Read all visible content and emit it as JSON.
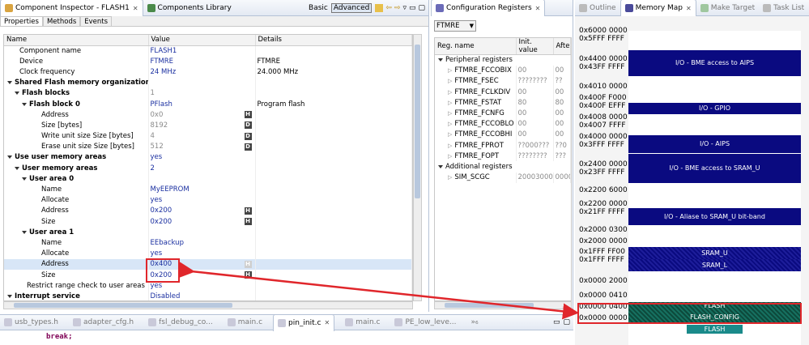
{
  "left_panel": {
    "tabs": [
      {
        "label": "Component Inspector - FLASH1"
      },
      {
        "label": "Components Library"
      }
    ],
    "toolbar": {
      "basic": "Basic",
      "advanced": "Advanced"
    },
    "subtabs": [
      "Properties",
      "Methods",
      "Events"
    ],
    "columns": [
      "Name",
      "Value",
      "Details"
    ],
    "rows": [
      {
        "name": "Component name",
        "value": "FLASH1",
        "details": "",
        "indent": 1,
        "bold": false,
        "vclass": "blue",
        "btn": ""
      },
      {
        "name": "Device",
        "value": "FTMRE",
        "details": "FTMRE",
        "indent": 1,
        "bold": false,
        "vclass": "blue",
        "btn": ""
      },
      {
        "name": "Clock frequency",
        "value": "24 MHz",
        "details": "24.000 MHz",
        "indent": 1,
        "bold": false,
        "vclass": "blue",
        "btn": ""
      },
      {
        "name": "Shared Flash memory organization",
        "value": "",
        "details": "",
        "indent": 0,
        "bold": true,
        "vclass": "",
        "btn": "",
        "tri": true
      },
      {
        "name": "Flash blocks",
        "value": "1",
        "details": "",
        "indent": 1,
        "bold": true,
        "vclass": "grey",
        "btn": "",
        "tri": true
      },
      {
        "name": "Flash block 0",
        "value": "PFlash",
        "details": "Program flash",
        "indent": 2,
        "bold": true,
        "vclass": "blue",
        "btn": "",
        "tri": true
      },
      {
        "name": "Address",
        "value": "0x0",
        "details": "",
        "indent": 4,
        "bold": false,
        "vclass": "grey",
        "btn": "H"
      },
      {
        "name": "Size [bytes]",
        "value": "8192",
        "details": "",
        "indent": 4,
        "bold": false,
        "vclass": "grey",
        "btn": "D"
      },
      {
        "name": "Write unit size Size [bytes]",
        "value": "4",
        "details": "",
        "indent": 4,
        "bold": false,
        "vclass": "grey",
        "btn": "D"
      },
      {
        "name": "Erase unit size Size [bytes]",
        "value": "512",
        "details": "",
        "indent": 4,
        "bold": false,
        "vclass": "grey",
        "btn": "D"
      },
      {
        "name": "Use user memory areas",
        "value": "yes",
        "details": "",
        "indent": 0,
        "bold": true,
        "vclass": "blue",
        "btn": "",
        "tri": true
      },
      {
        "name": "User memory areas",
        "value": "2",
        "details": "",
        "indent": 1,
        "bold": true,
        "vclass": "blue",
        "btn": "",
        "tri": true
      },
      {
        "name": "User area 0",
        "value": "",
        "details": "",
        "indent": 2,
        "bold": true,
        "vclass": "",
        "btn": "",
        "tri": true
      },
      {
        "name": "Name",
        "value": "MyEEPROM",
        "details": "",
        "indent": 4,
        "bold": false,
        "vclass": "blue",
        "btn": ""
      },
      {
        "name": "Allocate",
        "value": "yes",
        "details": "",
        "indent": 4,
        "bold": false,
        "vclass": "blue",
        "btn": ""
      },
      {
        "name": "Address",
        "value": "0x200",
        "details": "",
        "indent": 4,
        "bold": false,
        "vclass": "blue",
        "btn": "H"
      },
      {
        "name": "Size",
        "value": "0x200",
        "details": "",
        "indent": 4,
        "bold": false,
        "vclass": "blue",
        "btn": "H"
      },
      {
        "name": "User area 1",
        "value": "",
        "details": "",
        "indent": 2,
        "bold": true,
        "vclass": "",
        "btn": "",
        "tri": true
      },
      {
        "name": "Name",
        "value": "EEbackup",
        "details": "",
        "indent": 4,
        "bold": false,
        "vclass": "blue",
        "btn": ""
      },
      {
        "name": "Allocate",
        "value": "yes",
        "details": "",
        "indent": 4,
        "bold": false,
        "vclass": "blue",
        "btn": ""
      },
      {
        "name": "Address",
        "value": "0x400",
        "details": "",
        "indent": 4,
        "bold": false,
        "vclass": "",
        "btn": "H",
        "sel": true
      },
      {
        "name": "Size",
        "value": "0x200",
        "details": "",
        "indent": 4,
        "bold": false,
        "vclass": "blue",
        "btn": "H"
      },
      {
        "name": "Restrict range check to user areas",
        "value": "yes",
        "details": "",
        "indent": 2,
        "bold": false,
        "vclass": "blue",
        "btn": ""
      },
      {
        "name": "Interrupt service",
        "value": "Disabled",
        "details": "",
        "indent": 0,
        "bold": true,
        "vclass": "blue",
        "btn": "",
        "tri": true
      }
    ]
  },
  "config_panel": {
    "tab": "Configuration Registers",
    "dropdown": "FTMRE",
    "columns": [
      "Reg. name",
      "Init. value",
      "Afte"
    ],
    "groups": [
      {
        "label": "Peripheral registers",
        "items": [
          {
            "name": "FTMRE_FCCOBIX",
            "init": "00",
            "after": "00"
          },
          {
            "name": "FTMRE_FSEC",
            "init": "????????",
            "after": "??"
          },
          {
            "name": "FTMRE_FCLKDIV",
            "init": "00",
            "after": "00"
          },
          {
            "name": "FTMRE_FSTAT",
            "init": "80",
            "after": "80"
          },
          {
            "name": "FTMRE_FCNFG",
            "init": "00",
            "after": "00"
          },
          {
            "name": "FTMRE_FCCOBLO",
            "init": "00",
            "after": "00"
          },
          {
            "name": "FTMRE_FCCOBHI",
            "init": "00",
            "after": "00"
          },
          {
            "name": "FTMRE_FPROT",
            "init": "??000???",
            "after": "??0"
          },
          {
            "name": "FTMRE_FOPT",
            "init": "????????",
            "after": "???"
          }
        ]
      },
      {
        "label": "Additional registers",
        "items": [
          {
            "name": "SIM_SCGC",
            "init": "20003000",
            "after": "0000"
          }
        ]
      }
    ]
  },
  "right_panel": {
    "tabs": [
      "Outline",
      "Memory Map",
      "Make Target",
      "Task List"
    ],
    "addresses": [
      "0x6000 0000",
      "0x5FFF FFFF",
      "0x4400 0000",
      "0x43FF FFFF",
      "0x4010 0000",
      "0x400F F000",
      "0x400F EFFF",
      "0x4008 0000",
      "0x4007 FFFF",
      "0x4000 0000",
      "0x3FFF FFFF",
      "0x2400 0000",
      "0x23FF FFFF",
      "0x2200 6000",
      "0x2200 0000",
      "0x21FF FFFF",
      "0x2000 0300",
      "0x2000 0000",
      "0x1FFF FF00",
      "0x1FFF FFFF",
      "0x0000 2000",
      "0x0000 0410",
      "0x0000 0400",
      "0x0000 0000"
    ],
    "regions": [
      "I/O - BME access to AIPS",
      "I/O - GPIO",
      "I/O - AIPS",
      "I/O - BME access to SRAM_U",
      "I/O - Aliase to SRAM_U bit-band",
      "SRAM_U",
      "SRAM_L",
      "FLASH",
      "FLASH_CONFIG",
      "FLASH"
    ]
  },
  "bottom_tabs": [
    "usb_types.h",
    "adapter_cfg.h",
    "fsl_debug_co...",
    "main.c",
    "pin_init.c",
    "main.c",
    "PE_low_leve...",
    "»₆"
  ],
  "code_line": "break;"
}
